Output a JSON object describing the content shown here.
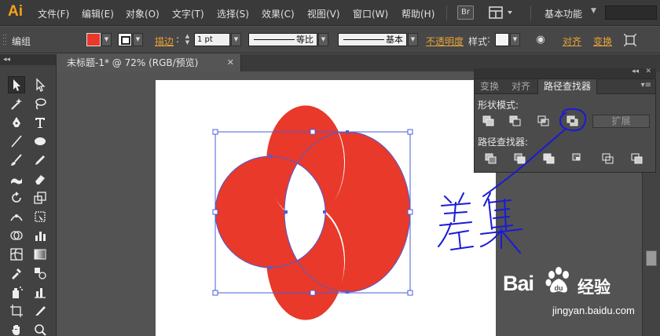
{
  "app": {
    "logo": "Ai"
  },
  "menu": {
    "items": [
      "文件(F)",
      "编辑(E)",
      "对象(O)",
      "文字(T)",
      "选择(S)",
      "效果(C)",
      "视图(V)",
      "窗口(W)",
      "帮助(H)"
    ],
    "bridge_label": "Br",
    "workspace": "基本功能"
  },
  "control_bar": {
    "selection_type": "编组",
    "stroke_label": "描边",
    "stroke_weight": "1 pt",
    "stroke_profile": "等比",
    "brush_definition": "基本",
    "opacity_label": "不透明度",
    "style_label": "样式",
    "align_label": "对齐",
    "transform_label": "变换",
    "colors": {
      "fill": "#e8392b",
      "stroke": "#ffffff",
      "accent": "#e8a23a"
    }
  },
  "document": {
    "tab_title": "未标题-1* @ 72% (RGB/预览)"
  },
  "artwork": {
    "fill_color": "#e8392b",
    "selection_color": "#4a5fd8"
  },
  "pathfinder": {
    "tabs": [
      "变换",
      "对齐",
      "路径查找器"
    ],
    "active_tab": "路径查找器",
    "shape_modes_label": "形状模式:",
    "pathfinders_label": "路径查找器:",
    "expand_label": "扩展"
  },
  "annotation": {
    "handwritten_text": "差集",
    "ink_color": "#1a1ad8"
  },
  "watermark": {
    "brand": "Bai",
    "brand_cn": "经验",
    "url": "jingyan.baidu.com"
  }
}
